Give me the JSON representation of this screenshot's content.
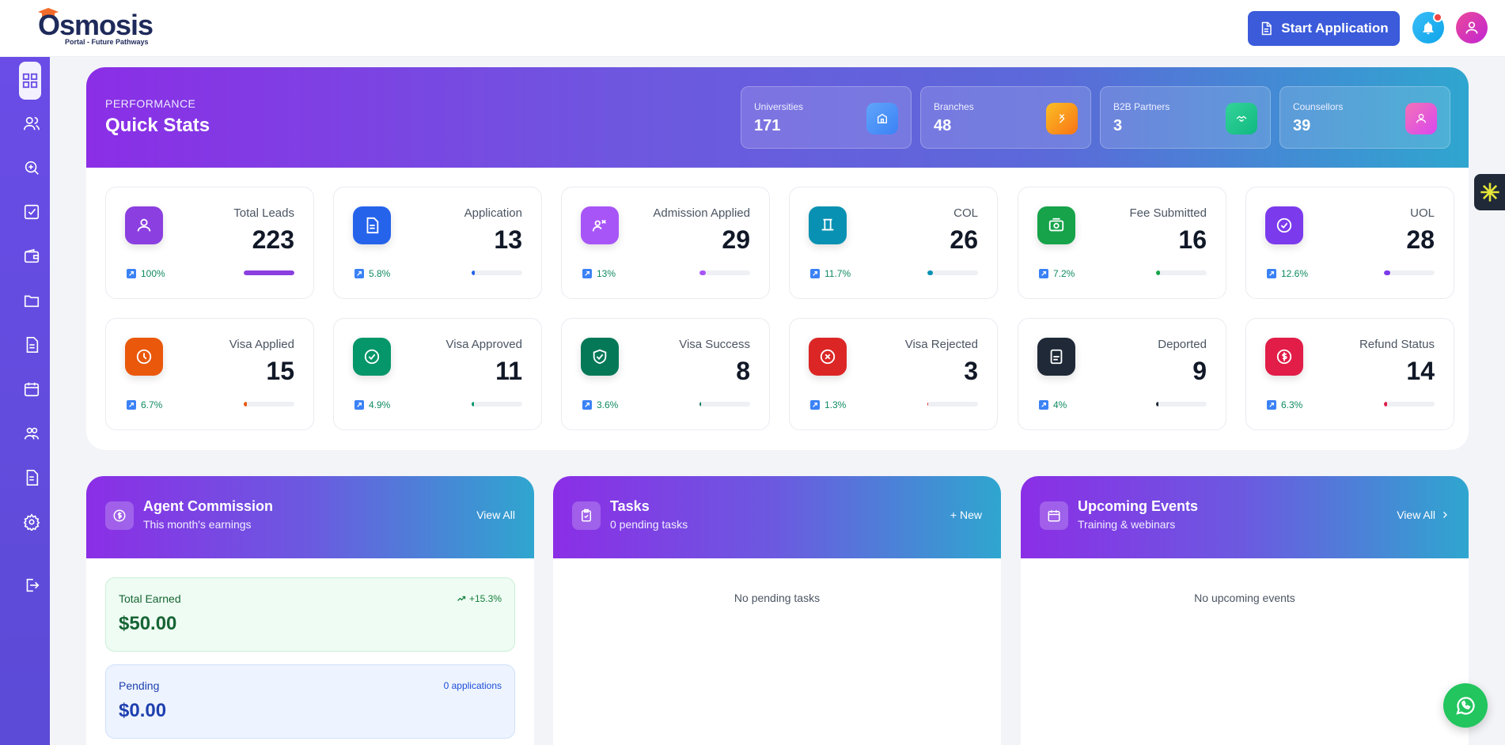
{
  "header": {
    "brand": "smosis",
    "brand_prefix": "O",
    "tagline": "Portal - Future Pathways",
    "start_button_label": "Start Application",
    "icons": [
      "bell-icon",
      "user-icon"
    ]
  },
  "sidebar": {
    "items": [
      {
        "icon": "grid-icon",
        "active": true
      },
      {
        "icon": "users-icon"
      },
      {
        "icon": "search-plus-icon"
      },
      {
        "icon": "checkbox-icon"
      },
      {
        "icon": "wallet-icon"
      },
      {
        "icon": "folder-icon"
      },
      {
        "icon": "document-icon"
      },
      {
        "icon": "calendar-icon"
      },
      {
        "icon": "team-icon"
      },
      {
        "icon": "file-icon"
      },
      {
        "icon": "gear-icon"
      },
      {
        "icon": "logout-icon"
      }
    ]
  },
  "hero": {
    "subtitle": "PERFORMANCE",
    "title": "Quick Stats",
    "mini_stats": [
      {
        "label": "Universities",
        "value": "171",
        "icon": "building-icon",
        "color": "#3b82f6"
      },
      {
        "label": "Branches",
        "value": "48",
        "icon": "branch-icon",
        "color": "#f59e0b"
      },
      {
        "label": "B2B Partners",
        "value": "3",
        "icon": "handshake-icon",
        "color": "#10b981"
      },
      {
        "label": "Counsellors",
        "value": "39",
        "icon": "person-icon",
        "color": "#ec4899"
      }
    ]
  },
  "stats": [
    {
      "label": "Total Leads",
      "value": "223",
      "trend": "100%",
      "progress": 1.0,
      "color": "#8b3fe0",
      "icon": "person-icon"
    },
    {
      "label": "Application",
      "value": "13",
      "trend": "5.8%",
      "progress": 0.058,
      "color": "#2563eb",
      "icon": "document-icon"
    },
    {
      "label": "Admission Applied",
      "value": "29",
      "trend": "13%",
      "progress": 0.13,
      "color": "#a855f7",
      "icon": "graduation-icon"
    },
    {
      "label": "COL",
      "value": "26",
      "trend": "11.7%",
      "progress": 0.117,
      "color": "#0891b2",
      "icon": "letter-icon"
    },
    {
      "label": "Fee Submitted",
      "value": "16",
      "trend": "7.2%",
      "progress": 0.072,
      "color": "#16a34a",
      "icon": "cash-icon"
    },
    {
      "label": "UOL",
      "value": "28",
      "trend": "12.6%",
      "progress": 0.126,
      "color": "#7c3aed",
      "icon": "check-circle-icon"
    },
    {
      "label": "Visa Applied",
      "value": "15",
      "trend": "6.7%",
      "progress": 0.067,
      "color": "#ea580c",
      "icon": "clock-icon"
    },
    {
      "label": "Visa Approved",
      "value": "11",
      "trend": "4.9%",
      "progress": 0.049,
      "color": "#059669",
      "icon": "check-circle-icon"
    },
    {
      "label": "Visa Success",
      "value": "8",
      "trend": "3.6%",
      "progress": 0.036,
      "color": "#047857",
      "icon": "shield-check-icon"
    },
    {
      "label": "Visa Rejected",
      "value": "3",
      "trend": "1.3%",
      "progress": 0.013,
      "color": "#dc2626",
      "icon": "x-circle-icon"
    },
    {
      "label": "Deported",
      "value": "9",
      "trend": "4%",
      "progress": 0.04,
      "color": "#1f2937",
      "icon": "passport-icon"
    },
    {
      "label": "Refund Status",
      "value": "14",
      "trend": "6.3%",
      "progress": 0.063,
      "color": "#e11d48",
      "icon": "dollar-icon"
    }
  ],
  "commission": {
    "title": "Agent Commission",
    "subtitle": "This month's earnings",
    "action": "View All",
    "total_label": "Total Earned",
    "total_trend": "+15.3%",
    "total_value": "$50.00",
    "pending_label": "Pending",
    "pending_count": "0 applications",
    "pending_value": "$0.00"
  },
  "tasks": {
    "title": "Tasks",
    "subtitle": "0 pending tasks",
    "action": "+ New",
    "empty": "No pending tasks"
  },
  "events": {
    "title": "Upcoming Events",
    "subtitle": "Training & webinars",
    "action": "View All",
    "empty": "No upcoming events"
  },
  "colors": {
    "sidebar": "#6a4ce6",
    "primary_button": "#3b5bdb",
    "whatsapp": "#22c55e"
  }
}
